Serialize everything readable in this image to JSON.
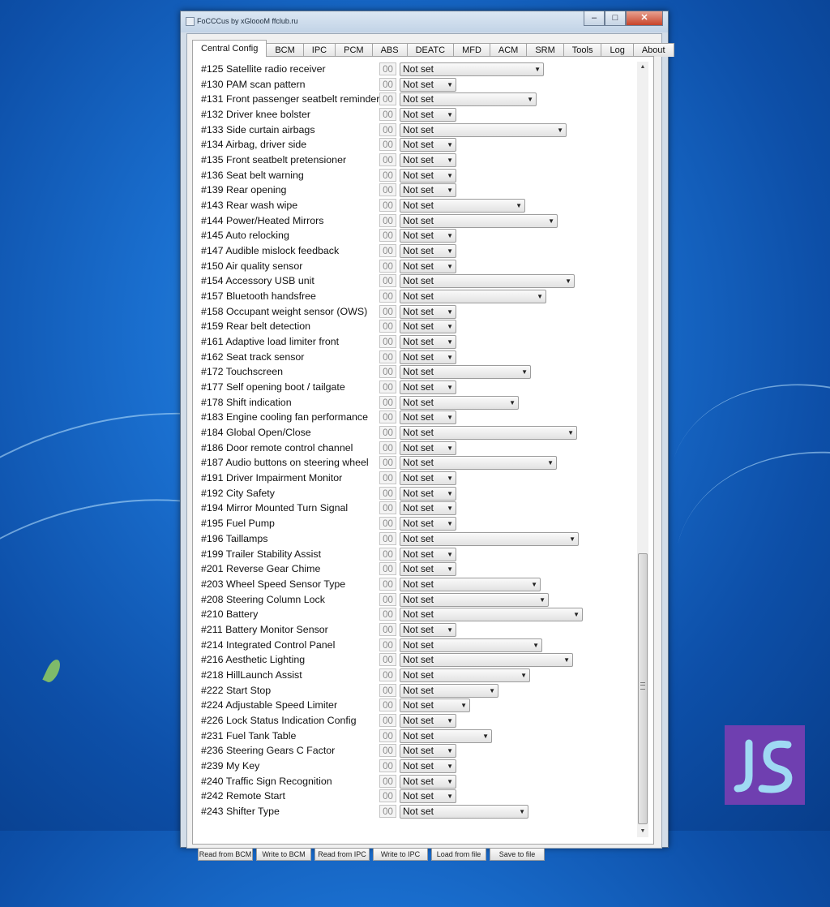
{
  "window": {
    "title": "FoCCCus by xGloooM ffclub.ru",
    "minimize": "–",
    "maximize": "□",
    "close": "✕"
  },
  "tabs": [
    "Central Config",
    "BCM",
    "IPC",
    "PCM",
    "ABS",
    "DEATC",
    "MFD",
    "ACM",
    "SRM",
    "Tools",
    "Log",
    "About"
  ],
  "rows": [
    {
      "label": "#125 Satellite radio receiver",
      "code": "00",
      "value": "Not set",
      "width": 178
    },
    {
      "label": "#130 PAM scan pattern",
      "code": "00",
      "value": "Not set",
      "width": 70
    },
    {
      "label": "#131 Front passenger seatbelt reminder",
      "code": "00",
      "value": "Not set",
      "width": 169
    },
    {
      "label": "#132 Driver knee bolster",
      "code": "00",
      "value": "Not set",
      "width": 70
    },
    {
      "label": "#133 Side curtain airbags",
      "code": "00",
      "value": "Not set",
      "width": 206
    },
    {
      "label": "#134 Airbag, driver side",
      "code": "00",
      "value": "Not set",
      "width": 70
    },
    {
      "label": "#135 Front seatbelt pretensioner",
      "code": "00",
      "value": "Not set",
      "width": 70
    },
    {
      "label": "#136 Seat belt warning",
      "code": "00",
      "value": "Not set",
      "width": 70
    },
    {
      "label": "#139 Rear opening",
      "code": "00",
      "value": "Not set",
      "width": 70
    },
    {
      "label": "#143 Rear wash wipe",
      "code": "00",
      "value": "Not set",
      "width": 155
    },
    {
      "label": "#144 Power/Heated Mirrors",
      "code": "00",
      "value": "Not set",
      "width": 195
    },
    {
      "label": "#145 Auto relocking",
      "code": "00",
      "value": "Not set",
      "width": 70
    },
    {
      "label": "#147 Audible mislock feedback",
      "code": "00",
      "value": "Not set",
      "width": 70
    },
    {
      "label": "#150 Air quality sensor",
      "code": "00",
      "value": "Not set",
      "width": 70
    },
    {
      "label": "#154 Accessory USB unit",
      "code": "00",
      "value": "Not set",
      "width": 216
    },
    {
      "label": "#157 Bluetooth handsfree",
      "code": "00",
      "value": "Not set",
      "width": 181
    },
    {
      "label": "#158 Occupant weight sensor (OWS)",
      "code": "00",
      "value": "Not set",
      "width": 70
    },
    {
      "label": "#159 Rear belt detection",
      "code": "00",
      "value": "Not set",
      "width": 70
    },
    {
      "label": "#161 Adaptive load limiter front",
      "code": "00",
      "value": "Not set",
      "width": 70
    },
    {
      "label": "#162 Seat track sensor",
      "code": "00",
      "value": "Not set",
      "width": 70
    },
    {
      "label": "#172 Touchscreen",
      "code": "00",
      "value": "Not set",
      "width": 162
    },
    {
      "label": "#177 Self opening boot / tailgate",
      "code": "00",
      "value": "Not set",
      "width": 70
    },
    {
      "label": "#178 Shift indication",
      "code": "00",
      "value": "Not set",
      "width": 147
    },
    {
      "label": "#183 Engine cooling fan performance",
      "code": "00",
      "value": "Not set",
      "width": 70
    },
    {
      "label": "#184 Global Open/Close",
      "code": "00",
      "value": "Not set",
      "width": 219
    },
    {
      "label": "#186 Door remote control channel",
      "code": "00",
      "value": "Not set",
      "width": 70
    },
    {
      "label": "#187 Audio buttons on steering wheel",
      "code": "00",
      "value": "Not set",
      "width": 194
    },
    {
      "label": "#191 Driver Impairment Monitor",
      "code": "00",
      "value": "Not set",
      "width": 70
    },
    {
      "label": "#192 City Safety",
      "code": "00",
      "value": "Not set",
      "width": 70
    },
    {
      "label": "#194 Mirror Mounted Turn Signal",
      "code": "00",
      "value": "Not set",
      "width": 70
    },
    {
      "label": "#195 Fuel Pump",
      "code": "00",
      "value": "Not set",
      "width": 70
    },
    {
      "label": "#196 Taillamps",
      "code": "00",
      "value": "Not set",
      "width": 221
    },
    {
      "label": "#199 Trailer Stability Assist",
      "code": "00",
      "value": "Not set",
      "width": 70
    },
    {
      "label": "#201 Reverse Gear Chime",
      "code": "00",
      "value": "Not set",
      "width": 70
    },
    {
      "label": "#203 Wheel Speed Sensor Type",
      "code": "00",
      "value": "Not set",
      "width": 174
    },
    {
      "label": "#208 Steering Column Lock",
      "code": "00",
      "value": "Not set",
      "width": 184
    },
    {
      "label": "#210 Battery",
      "code": "00",
      "value": "Not set",
      "width": 226
    },
    {
      "label": "#211 Battery Monitor Sensor",
      "code": "00",
      "value": "Not set",
      "width": 70
    },
    {
      "label": "#214 Integrated Control Panel",
      "code": "00",
      "value": "Not set",
      "width": 176
    },
    {
      "label": "#216 Aesthetic Lighting",
      "code": "00",
      "value": "Not set",
      "width": 214
    },
    {
      "label": "#218 HillLaunch Assist",
      "code": "00",
      "value": "Not set",
      "width": 161
    },
    {
      "label": "#222 Start Stop",
      "code": "00",
      "value": "Not set",
      "width": 122
    },
    {
      "label": "#224 Adjustable Speed Limiter",
      "code": "00",
      "value": "Not set",
      "width": 87
    },
    {
      "label": "#226 Lock Status Indication Config",
      "code": "00",
      "value": "Not set",
      "width": 70
    },
    {
      "label": "#231 Fuel Tank Table",
      "code": "00",
      "value": "Not set",
      "width": 114
    },
    {
      "label": "#236 Steering Gears C Factor",
      "code": "00",
      "value": "Not set",
      "width": 70
    },
    {
      "label": "#239 My Key",
      "code": "00",
      "value": "Not set",
      "width": 70
    },
    {
      "label": "#240 Traffic Sign Recognition",
      "code": "00",
      "value": "Not set",
      "width": 70
    },
    {
      "label": "#242 Remote Start",
      "code": "00",
      "value": "Not set",
      "width": 70
    },
    {
      "label": "#243 Shifter Type",
      "code": "00",
      "value": "Not set",
      "width": 159
    }
  ],
  "bottom_buttons": [
    "Read from BCM",
    "Write to BCM",
    "Read from IPC",
    "Write to IPC",
    "Load from file",
    "Save to file"
  ],
  "logo_text": "JS",
  "colors": {
    "accent": "#6f3fb0",
    "desktop": "#1a6fcf"
  }
}
